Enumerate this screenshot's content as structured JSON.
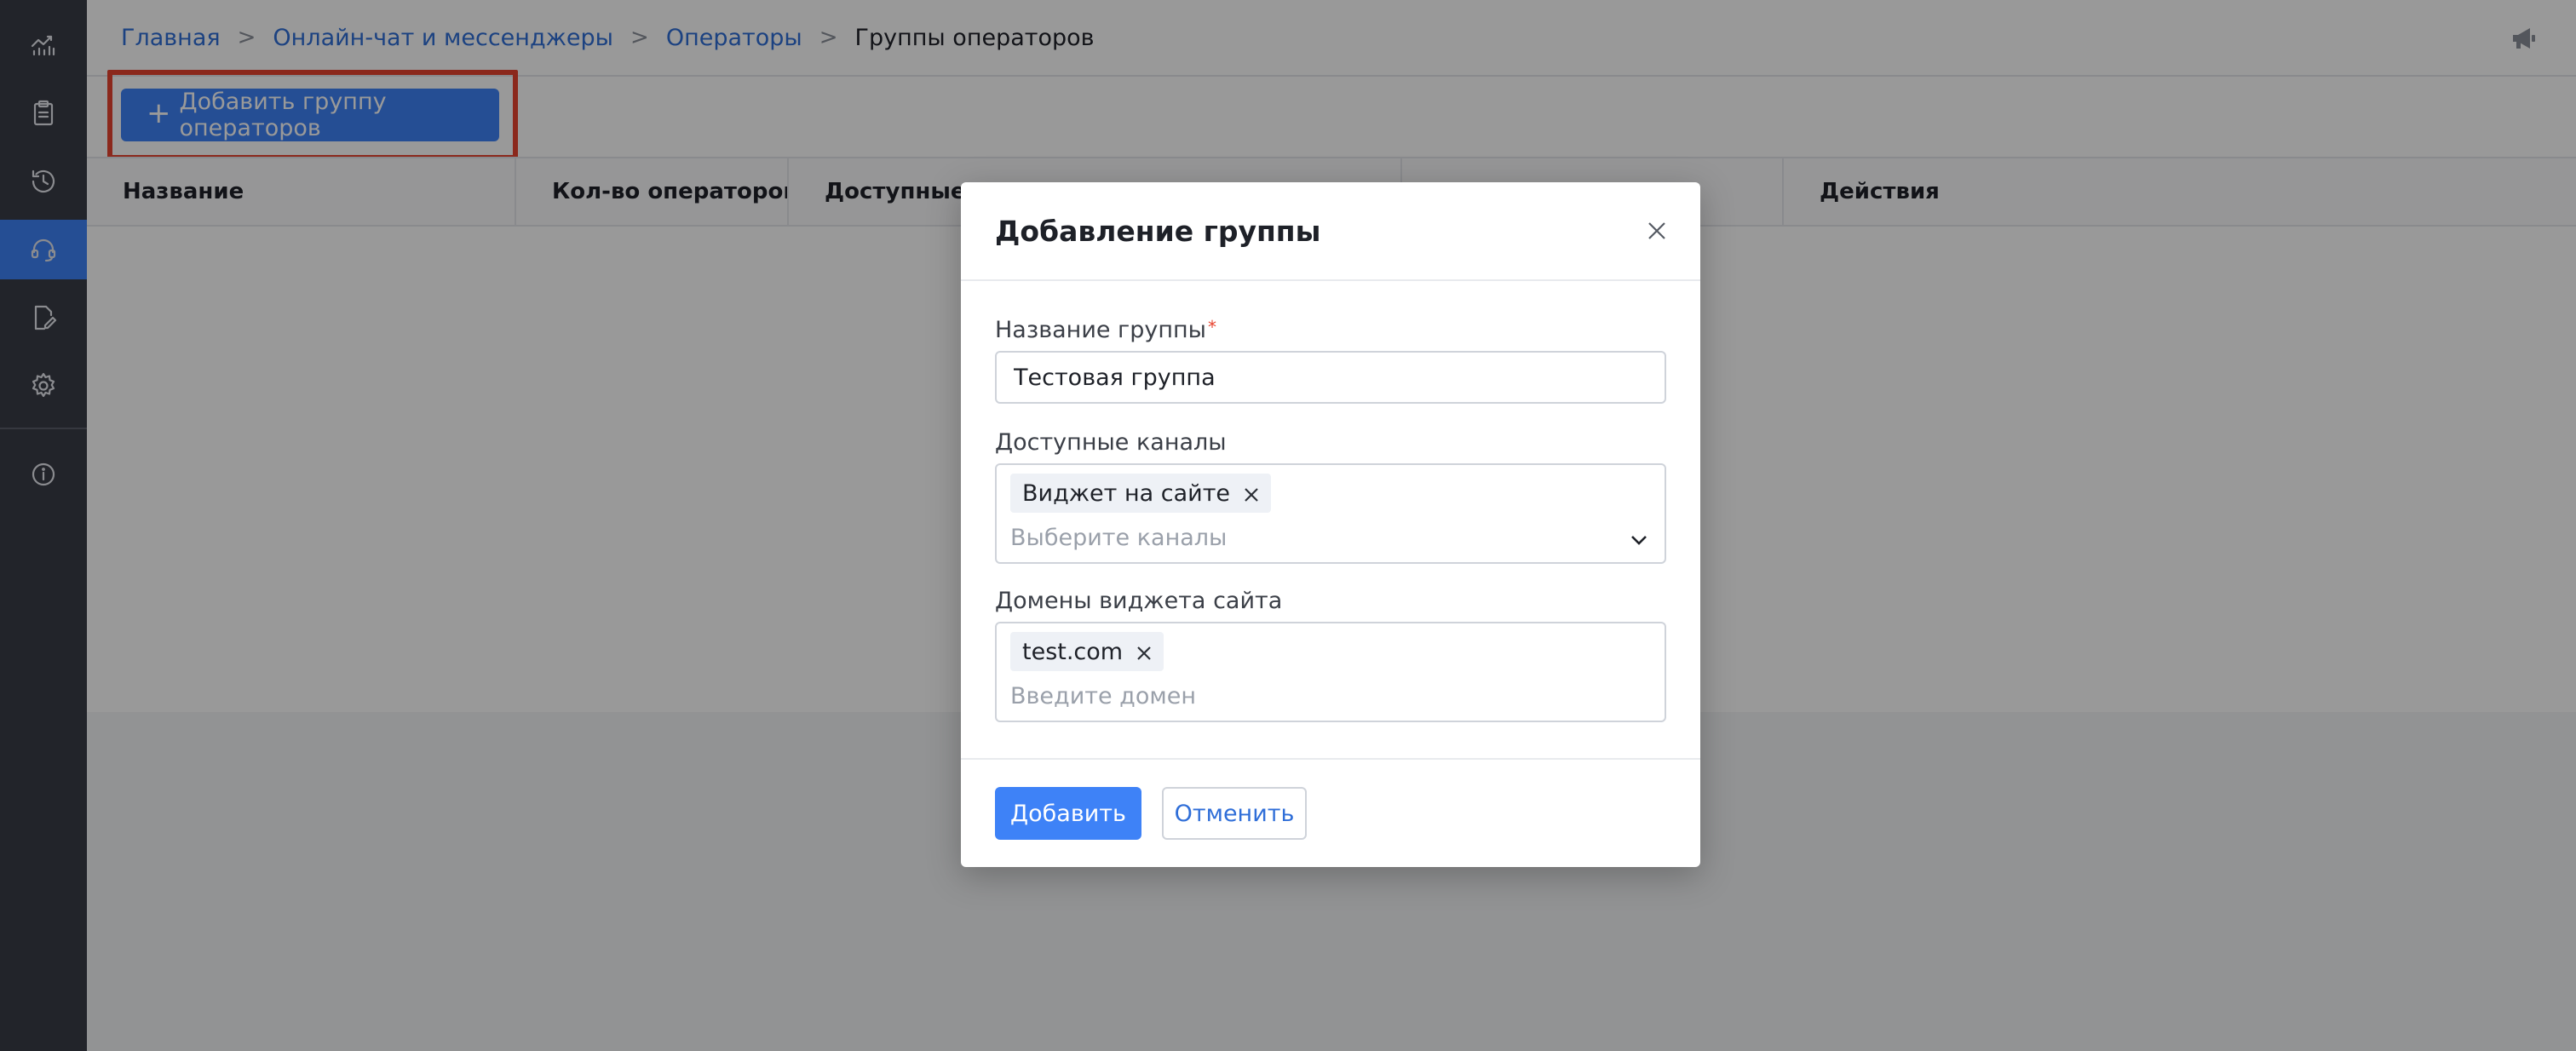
{
  "sidebar": {
    "items": [
      {
        "icon": "analytics-icon"
      },
      {
        "icon": "clipboard-icon"
      },
      {
        "icon": "history-icon"
      },
      {
        "icon": "headset-icon",
        "active": true
      },
      {
        "icon": "document-edit-icon"
      },
      {
        "icon": "gear-icon"
      },
      {
        "icon": "info-icon"
      }
    ]
  },
  "breadcrumb": {
    "items": [
      "Главная",
      "Онлайн-чат и мессенджеры",
      "Операторы"
    ],
    "current": "Группы операторов",
    "separator": ">"
  },
  "toolbar": {
    "add_group_label": "Добавить группу операторов",
    "add_group_icon": "+"
  },
  "table": {
    "columns": [
      "Название",
      "Кол-во операторов",
      "Доступные каналы",
      "",
      "Действия"
    ]
  },
  "modal": {
    "title": "Добавление группы",
    "group_name_label": "Название группы",
    "required_mark": "*",
    "group_name_value": "Тестовая группа",
    "channels_label": "Доступные каналы",
    "channels_tags": [
      "Виджет на сайте"
    ],
    "channels_placeholder": "Выберите каналы",
    "domains_label": "Домены виджета сайта",
    "domains_tags": [
      "test.com"
    ],
    "domains_placeholder": "Введите домен",
    "submit_label": "Добавить",
    "cancel_label": "Отменить"
  },
  "colors": {
    "accent": "#3e82f7",
    "sidebar_bg": "#3a3d47",
    "highlight": "#e8432f",
    "link": "#2f6ed8"
  }
}
